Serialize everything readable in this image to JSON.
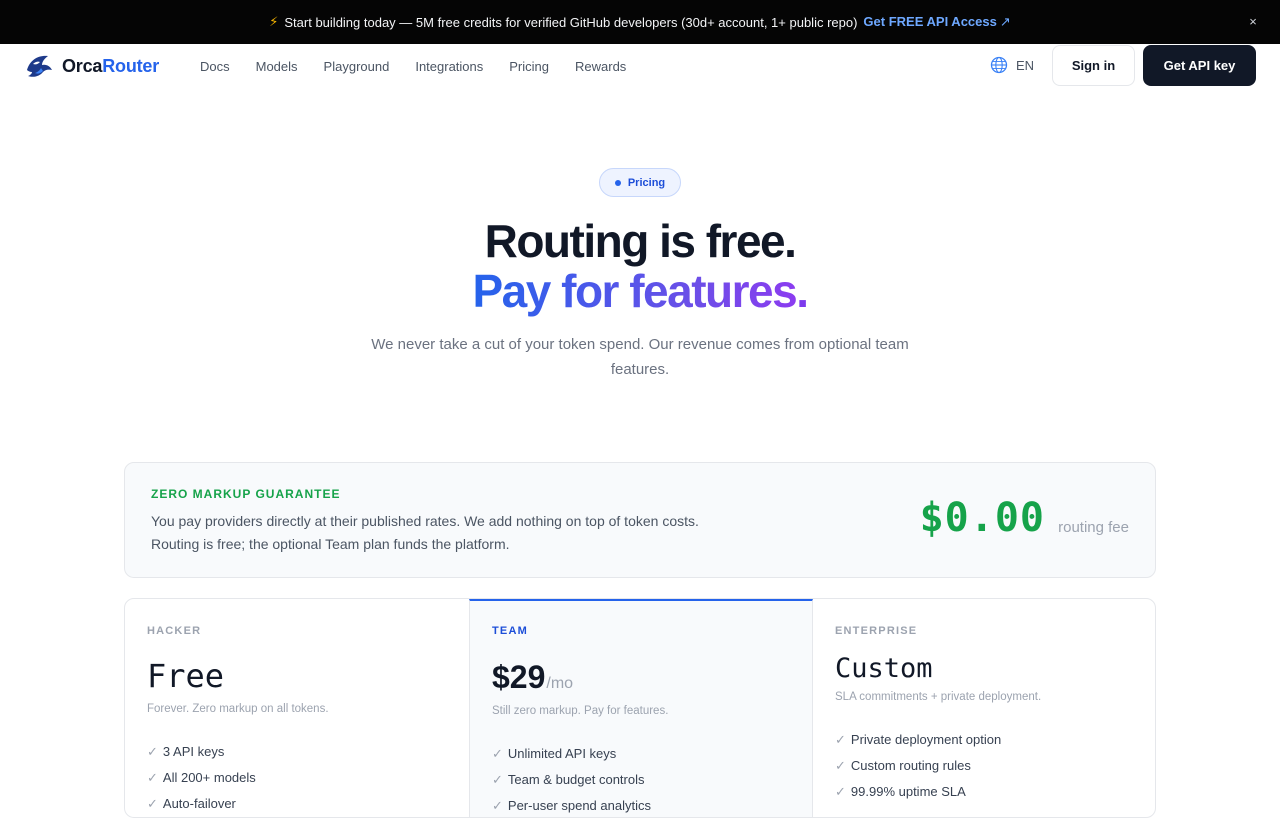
{
  "announcement": {
    "text": "Start building today — 5M free credits for verified GitHub developers (30d+ account, 1+ public repo)",
    "cta": "Get FREE API Access",
    "close": "×"
  },
  "nav": {
    "brand_a": "Orca",
    "brand_b": "Router",
    "links": [
      "Docs",
      "Models",
      "Playground",
      "Integrations",
      "Pricing",
      "Rewards"
    ],
    "lang": "EN",
    "signin": "Sign in",
    "api_key": "Get API key"
  },
  "hero": {
    "pill": "Pricing",
    "title": "Routing is free.",
    "title_accent": "Pay for features",
    "title_period": ".",
    "subtitle": "We never take a cut of your token spend. Our revenue comes from optional team features."
  },
  "guarantee": {
    "kicker": "ZERO MARKUP GUARANTEE",
    "description": "You pay providers directly at their published rates. We add nothing on top of token costs. Routing is free; the optional Team plan funds the platform.",
    "price": "$0.00",
    "fee_label": "routing fee"
  },
  "plans": [
    {
      "tier": "HACKER",
      "price": "Free",
      "period": "",
      "note": "Forever. Zero markup on all tokens.",
      "features": [
        "3 API keys",
        "All 200+ models",
        "Auto-failover"
      ]
    },
    {
      "tier": "TEAM",
      "price": "$29",
      "period": "/mo",
      "note": "Still zero markup. Pay for features.",
      "features": [
        "Unlimited API keys",
        "Team & budget controls",
        "Per-user spend analytics"
      ]
    },
    {
      "tier": "ENTERPRISE",
      "price": "Custom",
      "period": "",
      "note": "SLA commitments + private deployment.",
      "features": [
        "Private deployment option",
        "Custom routing rules",
        "99.99% uptime SLA"
      ]
    }
  ],
  "colors": {
    "accent_blue": "#2563eb",
    "accent_purple": "#7c3aed",
    "success_green": "#16a34a",
    "dark": "#111827"
  }
}
